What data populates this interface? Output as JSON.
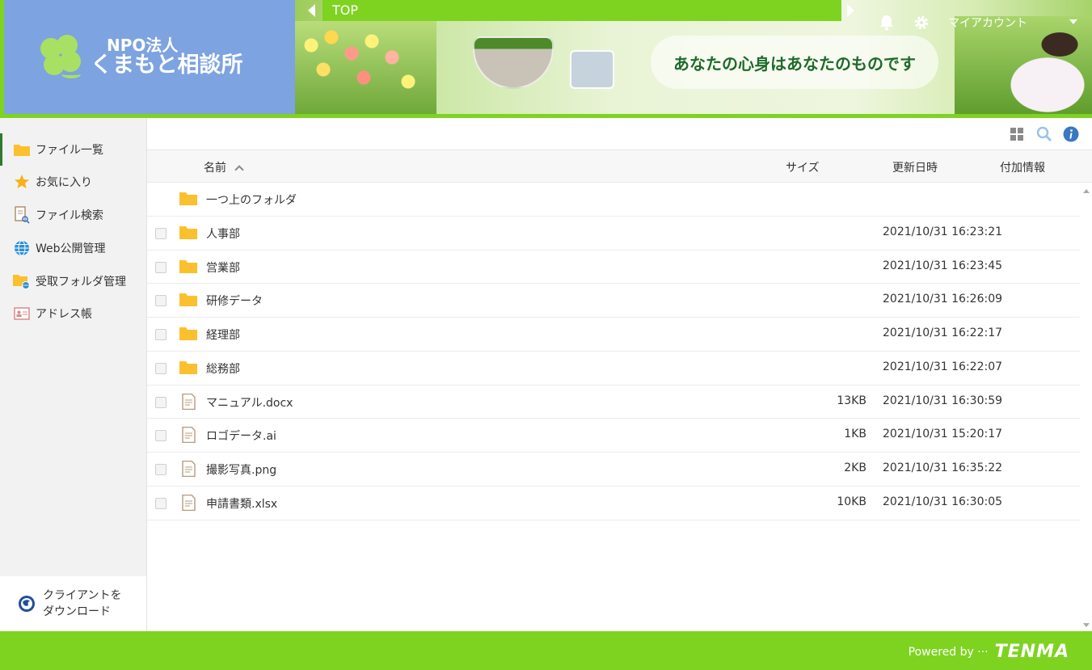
{
  "header": {
    "logo_line1": "NPO法人",
    "logo_line2": "くまもと相談所",
    "slogan": "あなたの心身はあなたのものです",
    "breadcrumb": "TOP",
    "account_label": "マイアカウント"
  },
  "sidebar": {
    "items": [
      {
        "label": "ファイル一覧",
        "icon": "folder-icon"
      },
      {
        "label": "お気に入り",
        "icon": "star-icon"
      },
      {
        "label": "ファイル検索",
        "icon": "file-search-icon"
      },
      {
        "label": "Web公開管理",
        "icon": "globe-icon"
      },
      {
        "label": "受取フォルダ管理",
        "icon": "folder-globe-icon"
      },
      {
        "label": "アドレス帳",
        "icon": "address-card-icon"
      }
    ],
    "download_line1": "クライアントを",
    "download_line2": "ダウンロード"
  },
  "columns": {
    "name": "名前",
    "size": "サイズ",
    "modified": "更新日時",
    "info": "付加情報"
  },
  "parent_folder": "一つ上のフォルダ",
  "rows": [
    {
      "name": "人事部",
      "type": "folder",
      "size": "",
      "date": "2021/10/31 16:23:21"
    },
    {
      "name": "営業部",
      "type": "folder",
      "size": "",
      "date": "2021/10/31 16:23:45"
    },
    {
      "name": "研修データ",
      "type": "folder",
      "size": "",
      "date": "2021/10/31 16:26:09"
    },
    {
      "name": "経理部",
      "type": "folder",
      "size": "",
      "date": "2021/10/31 16:22:17"
    },
    {
      "name": "総務部",
      "type": "folder",
      "size": "",
      "date": "2021/10/31 16:22:07"
    },
    {
      "name": "マニュアル.docx",
      "type": "file",
      "size": "13KB",
      "date": "2021/10/31 16:30:59"
    },
    {
      "name": "ロゴデータ.ai",
      "type": "file",
      "size": "1KB",
      "date": "2021/10/31 15:20:17"
    },
    {
      "name": "撮影写真.png",
      "type": "file",
      "size": "2KB",
      "date": "2021/10/31 16:35:22"
    },
    {
      "name": "申請書類.xlsx",
      "type": "file",
      "size": "10KB",
      "date": "2021/10/31 16:30:05"
    }
  ],
  "footer": {
    "powered_by": "Powered by ···",
    "brand": "TENMA"
  },
  "colors": {
    "accent_green": "#7ed321",
    "logo_blue": "#7da3e0",
    "folder_yellow": "#fbc02d"
  }
}
